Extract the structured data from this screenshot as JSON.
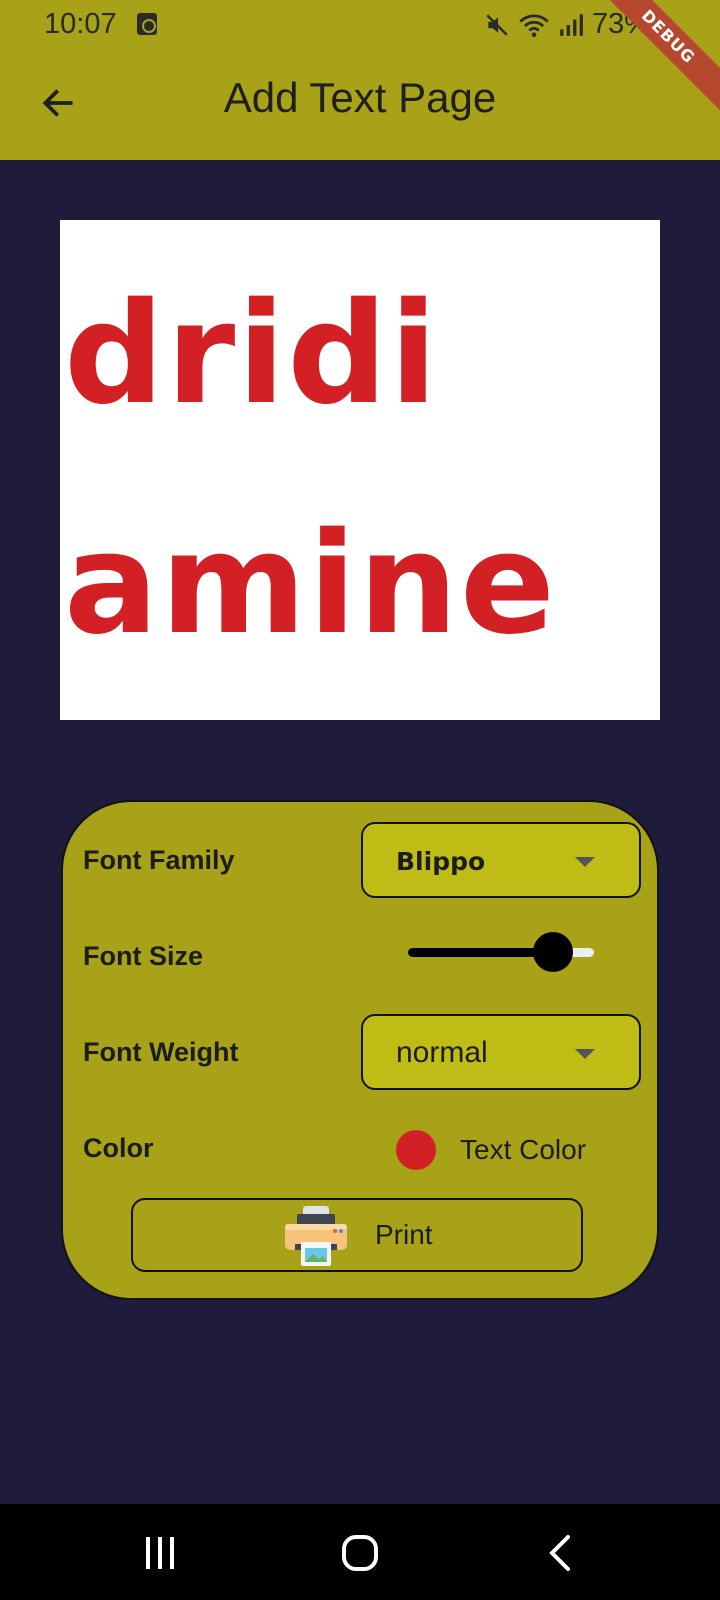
{
  "status_bar": {
    "time": "10:07",
    "battery": "73%",
    "icons": [
      "screen-record-icon",
      "mute-icon",
      "wifi-icon",
      "signal-icon",
      "battery-icon"
    ]
  },
  "debug_banner": "DEBUG",
  "app_bar": {
    "title": "Add Text Page",
    "back_icon": "arrow-left-icon"
  },
  "preview": {
    "lines": [
      "dridi",
      "amine"
    ],
    "text_color": "#d22025",
    "background": "#ffffff"
  },
  "controls": {
    "font_family_label": "Font Family",
    "font_family_value": "Blippo",
    "font_size_label": "Font Size",
    "font_size_slider_fraction": 0.78,
    "font_weight_label": "Font Weight",
    "font_weight_value": "normal",
    "color_label": "Color",
    "color_button_label": "Text Color",
    "selected_color": "#d22025",
    "print_label": "Print",
    "print_icon": "printer-icon"
  },
  "nav_bar": {
    "icons": [
      "recent-apps-icon",
      "home-icon",
      "nav-back-icon"
    ]
  },
  "colors": {
    "app_bar": "#a8a219",
    "background": "#1f1c3b",
    "dropdown": "#c0bc16"
  }
}
